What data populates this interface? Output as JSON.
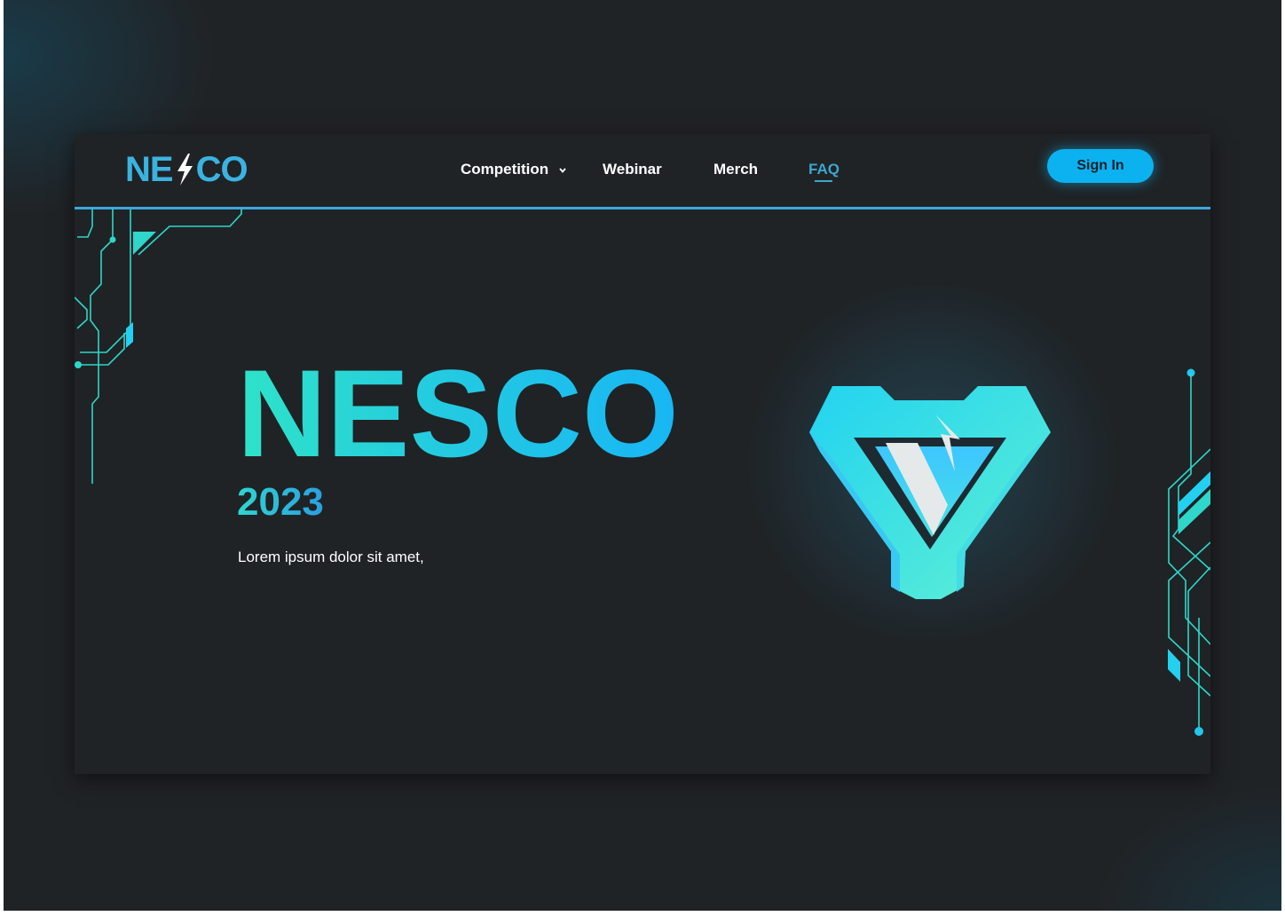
{
  "brand": {
    "logo_left": "NE",
    "logo_right": "CO",
    "accent": "#0cb2f0",
    "teal": "#2fe3c8",
    "background": "#1f2326"
  },
  "nav": {
    "items": [
      {
        "label": "Competition",
        "has_dropdown": true,
        "active": false
      },
      {
        "label": "Webinar",
        "has_dropdown": false,
        "active": false
      },
      {
        "label": "Merch",
        "has_dropdown": false,
        "active": false
      },
      {
        "label": "FAQ",
        "has_dropdown": false,
        "active": true
      }
    ],
    "signin_label": "Sign In"
  },
  "hero": {
    "title": "NESCO",
    "year": "2023",
    "subtitle": "Lorem ipsum dolor sit amet,"
  },
  "icons": {
    "logo_bolt": "lightning-bolt-icon",
    "dropdown": "chevron-down-icon",
    "emblem": "nesco-emblem-icon"
  }
}
